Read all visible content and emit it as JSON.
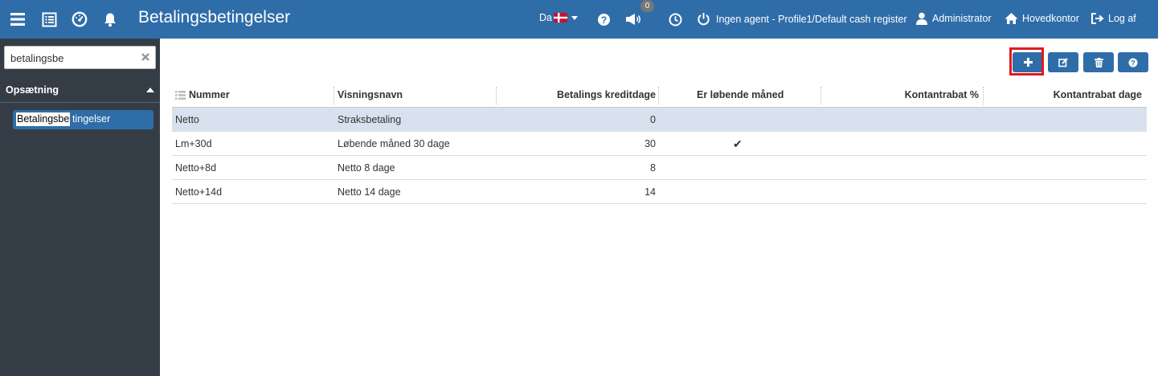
{
  "header": {
    "title": "Betalingsbetingelser",
    "language": "Da",
    "notification_count": "0",
    "agent_status": "Ingen agent - Profile1/Default cash register",
    "user": "Administrator",
    "location": "Hovedkontor",
    "logout": "Log af",
    "colors": {
      "bar": "#2f6da9"
    }
  },
  "sidebar": {
    "search": {
      "value": "betalingsbe",
      "placeholder": ""
    },
    "section": "Opsætning",
    "items": [
      {
        "match": "Betalingsbe",
        "rest": "tingelser"
      }
    ]
  },
  "toolbar": {
    "buttons": [
      "add-icon",
      "edit-icon",
      "delete-icon",
      "help-icon"
    ],
    "highlight_color": "#e1191f"
  },
  "table": {
    "columns": [
      "Nummer",
      "Visningsnavn",
      "Betalings kreditdage",
      "Er løbende måned",
      "Kontantrabat %",
      "Kontantrabat dage"
    ],
    "rows": [
      {
        "nummer": "Netto",
        "navn": "Straksbetaling",
        "kreditdage": "0",
        "lobende": "",
        "rabat_pct": "",
        "rabat_dage": ""
      },
      {
        "nummer": "Lm+30d",
        "navn": "Løbende måned 30 dage",
        "kreditdage": "30",
        "lobende": "✔",
        "rabat_pct": "",
        "rabat_dage": ""
      },
      {
        "nummer": "Netto+8d",
        "navn": "Netto 8 dage",
        "kreditdage": "8",
        "lobende": "",
        "rabat_pct": "",
        "rabat_dage": ""
      },
      {
        "nummer": "Netto+14d",
        "navn": "Netto 14 dage",
        "kreditdage": "14",
        "lobende": "",
        "rabat_pct": "",
        "rabat_dage": ""
      }
    ]
  }
}
